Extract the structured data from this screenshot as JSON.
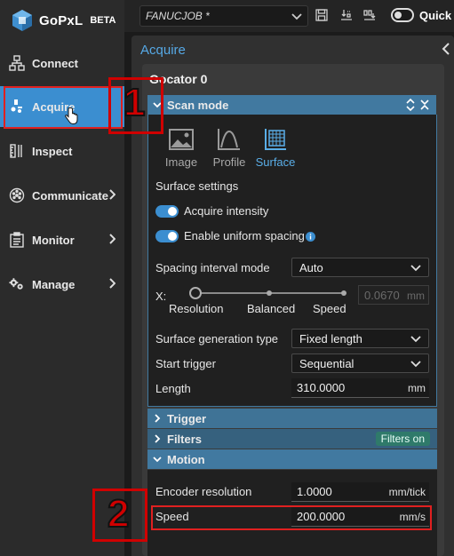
{
  "app": {
    "name": "GoPxL",
    "badge": "BETA"
  },
  "sidebar": {
    "items": [
      {
        "label": "Connect",
        "icon": "connect-icon",
        "has_submenu": false,
        "active": false
      },
      {
        "label": "Acquire",
        "icon": "acquire-icon",
        "has_submenu": false,
        "active": true
      },
      {
        "label": "Inspect",
        "icon": "inspect-icon",
        "has_submenu": false,
        "active": false
      },
      {
        "label": "Communicate",
        "icon": "communicate-icon",
        "has_submenu": true,
        "active": false
      },
      {
        "label": "Monitor",
        "icon": "monitor-icon",
        "has_submenu": true,
        "active": false
      },
      {
        "label": "Manage",
        "icon": "manage-icon",
        "has_submenu": true,
        "active": false
      }
    ]
  },
  "toolbar": {
    "job_name": "FANUCJOB *",
    "quick_label": "Quick e",
    "icons": [
      "save-icon",
      "download-icon",
      "export-icon"
    ]
  },
  "panel": {
    "title": "Acquire",
    "sensor_title": "Gocator 0",
    "scan_mode": {
      "title": "Scan mode",
      "modes": [
        {
          "label": "Image",
          "icon": "image-icon",
          "active": false
        },
        {
          "label": "Profile",
          "icon": "profile-icon",
          "active": false
        },
        {
          "label": "Surface",
          "icon": "surface-icon",
          "active": true
        }
      ],
      "surface_settings_label": "Surface settings",
      "acquire_intensity": {
        "label": "Acquire intensity",
        "on": true
      },
      "uniform_spacing": {
        "label": "Enable uniform spacing",
        "on": true
      },
      "spacing_interval_mode": {
        "label": "Spacing interval mode",
        "value": "Auto"
      },
      "slider": {
        "axis_label": "X:",
        "stops": [
          "Resolution",
          "Balanced",
          "Speed"
        ],
        "value": "0.0670",
        "unit": "mm",
        "position": 0
      },
      "surface_generation_type": {
        "label": "Surface generation type",
        "value": "Fixed length"
      },
      "start_trigger": {
        "label": "Start trigger",
        "value": "Sequential"
      },
      "length": {
        "label": "Length",
        "value": "310.0000",
        "unit": "mm"
      }
    },
    "sections": {
      "trigger": "Trigger",
      "filters": "Filters",
      "filters_badge": "Filters on",
      "motion": "Motion"
    },
    "motion": {
      "encoder_resolution": {
        "label": "Encoder resolution",
        "value": "1.0000",
        "unit": "mm/tick"
      },
      "speed": {
        "label": "Speed",
        "value": "200.0000",
        "unit": "mm/s"
      }
    }
  },
  "annotations": {
    "step1": "1",
    "step2": "2"
  },
  "colors": {
    "accent": "#3b8ed0",
    "section": "#4179a0",
    "marker": "#d00000"
  }
}
